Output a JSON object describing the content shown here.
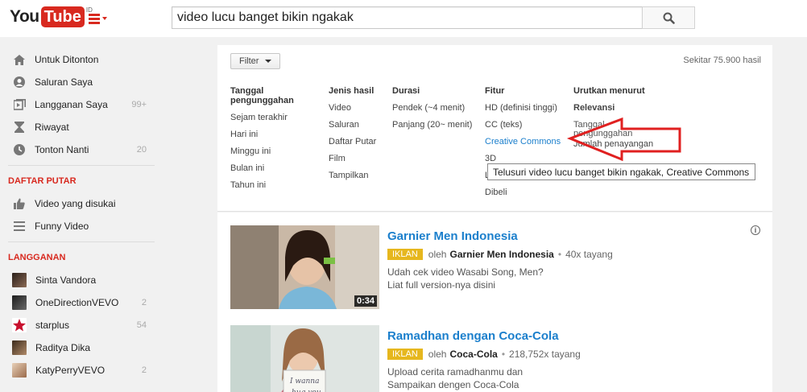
{
  "header": {
    "logo_you": "You",
    "logo_tube": "Tube",
    "logo_country": "ID",
    "search_value": "video lucu banget bikin ngakak"
  },
  "sidebar": {
    "main_items": [
      {
        "label": "Untuk Ditonton",
        "icon": "home-icon",
        "count": ""
      },
      {
        "label": "Saluran Saya",
        "icon": "user-icon",
        "count": ""
      },
      {
        "label": "Langganan Saya",
        "icon": "subscriptions-icon",
        "count": "99+"
      },
      {
        "label": "Riwayat",
        "icon": "hourglass-icon",
        "count": ""
      },
      {
        "label": "Tonton Nanti",
        "icon": "clock-icon",
        "count": "20"
      }
    ],
    "playlist_heading": "DAFTAR PUTAR",
    "playlist_items": [
      {
        "label": "Video yang disukai",
        "icon": "thumbs-up-icon"
      },
      {
        "label": "Funny Video",
        "icon": "playlist-icon"
      }
    ],
    "subs_heading": "LANGGANAN",
    "subs_items": [
      {
        "label": "Sinta Vandora",
        "count": "",
        "color": "#5a4a3f"
      },
      {
        "label": "OneDirectionVEVO",
        "count": "2",
        "color": "#3a3a3a"
      },
      {
        "label": "starplus",
        "count": "54",
        "color": "#c8102e"
      },
      {
        "label": "Raditya Dika",
        "count": "",
        "color": "#7a5a40"
      },
      {
        "label": "KatyPerryVEVO",
        "count": "2",
        "color": "#c9a27c"
      }
    ]
  },
  "filter": {
    "button_label": "Filter",
    "result_count": "Sekitar 75.900 hasil",
    "columns": [
      {
        "heading": "Tanggal pengunggahan",
        "items": [
          "Sejam terakhir",
          "Hari ini",
          "Minggu ini",
          "Bulan ini",
          "Tahun ini"
        ]
      },
      {
        "heading": "Jenis hasil",
        "items": [
          "Video",
          "Saluran",
          "Daftar Putar",
          "Film",
          "Tampilkan"
        ]
      },
      {
        "heading": "Durasi",
        "items": [
          "Pendek (~4 menit)",
          "Panjang (20~ menit)"
        ]
      },
      {
        "heading": "Fitur",
        "items": [
          "HD (definisi tinggi)",
          "CC (teks)",
          "Creative Commons",
          "3D",
          "Live",
          "Dibeli"
        ]
      },
      {
        "heading": "Urutkan menurut",
        "items": [
          "Relevansi",
          "Tanggal pengunggahan",
          "Jumlah penayangan"
        ]
      }
    ],
    "tooltip": "Telusuri video lucu banget bikin ngakak, Creative Commons"
  },
  "results": [
    {
      "title": "Garnier Men Indonesia",
      "badge": "IKLAN",
      "by": "oleh",
      "channel": "Garnier Men Indonesia",
      "views": "40x tayang",
      "desc1": "Udah cek video Wasabi Song, Men?",
      "desc2": "Liat full version-nya disini",
      "duration": "0:34"
    },
    {
      "title": "Ramadhan dengan Coca-Cola",
      "badge": "IKLAN",
      "by": "oleh",
      "channel": "Coca-Cola",
      "views": "218,752x tayang",
      "desc1": "Upload cerita ramadhanmu dan",
      "desc2": "Sampaikan dengen Coca-Cola",
      "duration": ""
    }
  ],
  "colors": {
    "brand_red": "#d8291f",
    "link_blue": "#1b7fcc",
    "ad_badge": "#e6b71e",
    "annotation_arrow": "#e02020"
  }
}
